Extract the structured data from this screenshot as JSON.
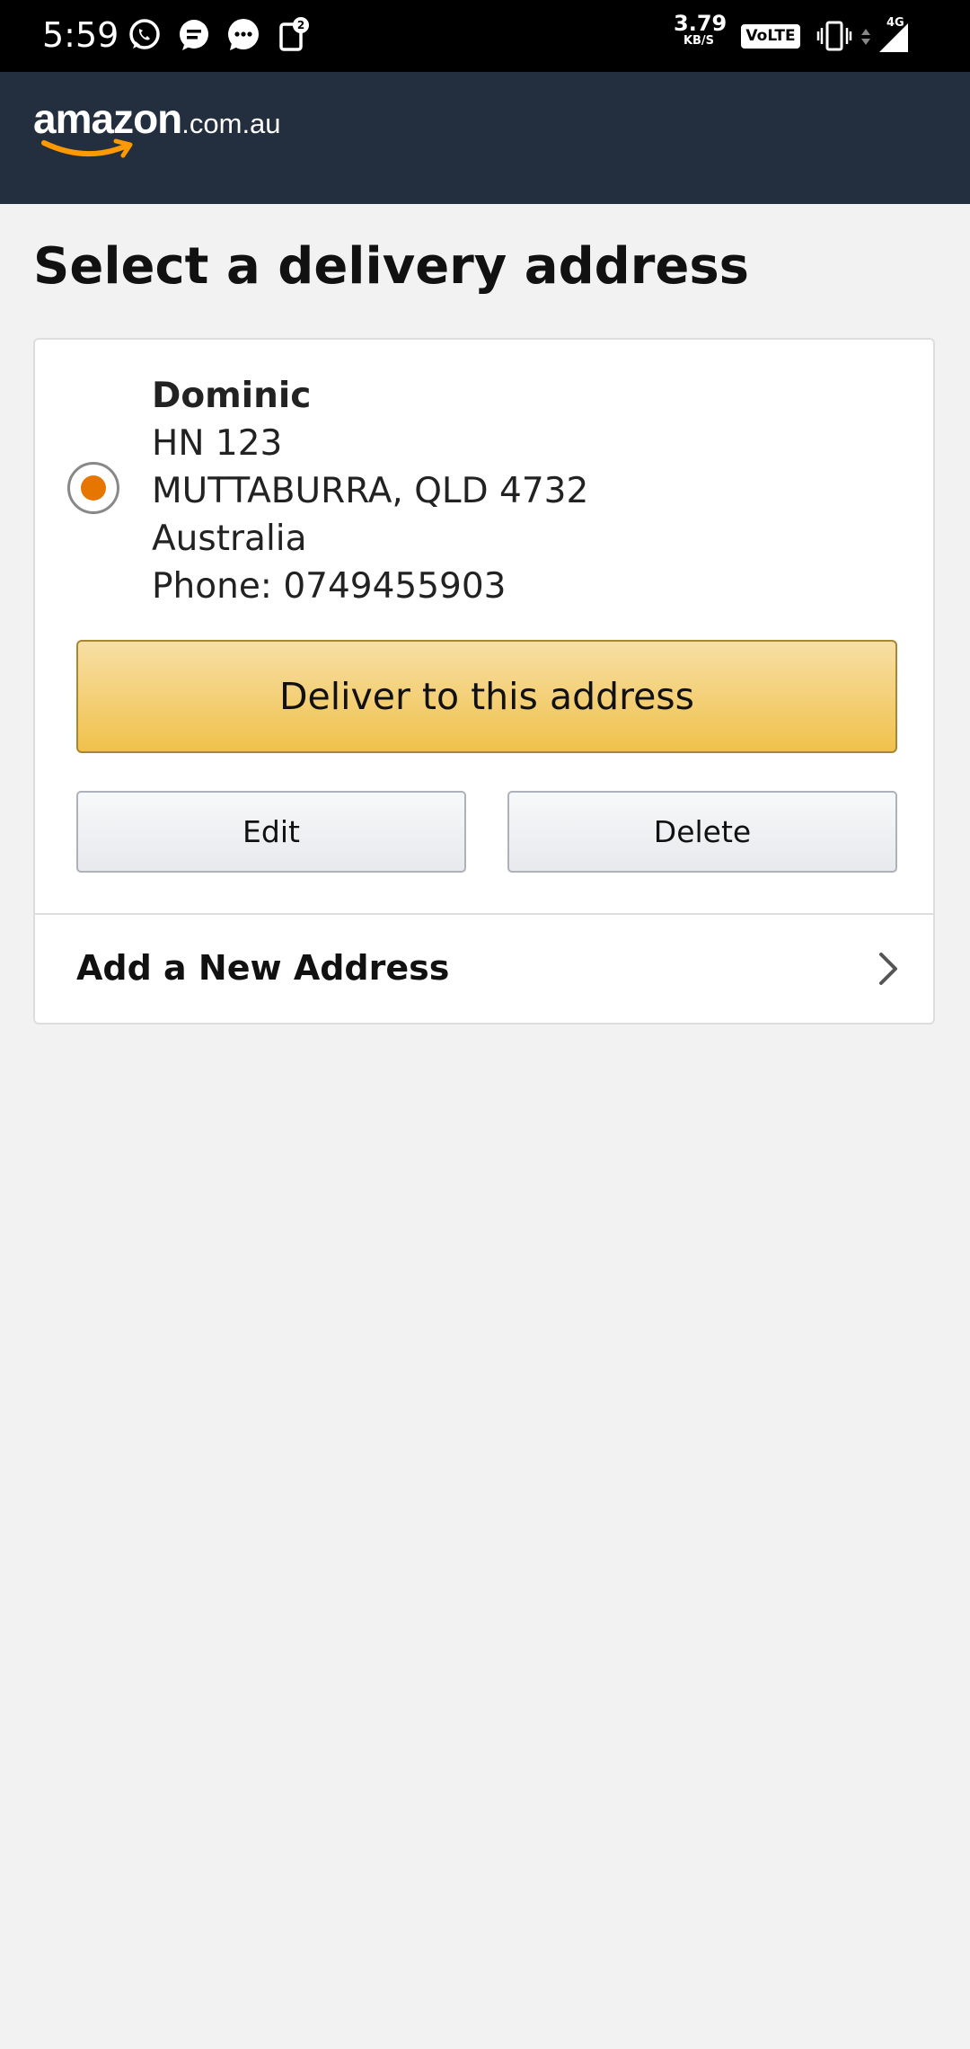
{
  "status_bar": {
    "time": "5:59",
    "net_speed": "3.79",
    "net_speed_unit": "KB/S",
    "volte": "VoLTE",
    "network_type": "4G",
    "notification_icons": [
      "whatsapp-icon",
      "message-icon",
      "chat-icon",
      "notification-2-icon"
    ]
  },
  "header": {
    "logo_word": "amazon",
    "logo_tld": ".com.au",
    "background": "#232f3e",
    "smile_color": "#ff9900"
  },
  "page": {
    "title": "Select a delivery address"
  },
  "address": {
    "selected": true,
    "name": "Dominic",
    "line1": "HN 123",
    "line2": "MUTTABURRA, QLD 4732",
    "country": "Australia",
    "phone": "Phone: 0749455903",
    "radio_color": "#e77600"
  },
  "actions": {
    "deliver_label": "Deliver to this address",
    "edit_label": "Edit",
    "delete_label": "Delete"
  },
  "add_address": {
    "label": "Add a New Address",
    "icon": "chevron-right-icon"
  }
}
